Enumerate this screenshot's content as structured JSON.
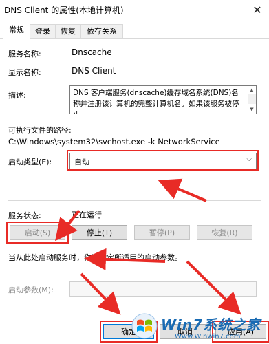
{
  "window": {
    "title": "DNS Client 的属性(本地计算机)",
    "close_glyph": "✕"
  },
  "tabs": [
    {
      "label": "常规",
      "active": true
    },
    {
      "label": "登录",
      "active": false
    },
    {
      "label": "恢复",
      "active": false
    },
    {
      "label": "依存关系",
      "active": false
    }
  ],
  "general": {
    "service_name_label": "服务名称:",
    "service_name_value": "Dnscache",
    "display_name_label": "显示名称:",
    "display_name_value": "DNS Client",
    "description_label": "描述:",
    "description_value": "DNS 客户端服务(dnscache)缓存域名系统(DNS)名称并注册该计算机的完整计算机名。如果该服务被停止，",
    "path_label": "可执行文件的路径:",
    "path_value": "C:\\Windows\\system32\\svchost.exe -k NetworkService",
    "startup_type_label": "启动类型(E):",
    "startup_type_value": "自动",
    "status_label": "服务状态:",
    "status_value": "正在运行"
  },
  "service_buttons": {
    "start": "启动(S)",
    "stop": "停止(T)",
    "pause": "暂停(P)",
    "resume": "恢复(R)"
  },
  "hint_text": "当从此处启动服务时，你可指定所适用的启动参数。",
  "start_params_label": "启动参数(M):",
  "start_params_value": "",
  "dialog_buttons": {
    "ok": "确定",
    "cancel": "取消",
    "apply": "应用(A)"
  },
  "watermark": {
    "brand": "Win7系统之家",
    "url": "Www.Winwin7.com"
  },
  "colors": {
    "annotation_red": "#e82b26",
    "focus_blue": "#0078d7",
    "watermark_blue": "#1a6bb3"
  },
  "icons": {
    "close": "close-icon",
    "dropdown": "chevron-down-icon",
    "scroll_up": "scroll-up-icon",
    "scroll_down": "scroll-down-icon"
  }
}
